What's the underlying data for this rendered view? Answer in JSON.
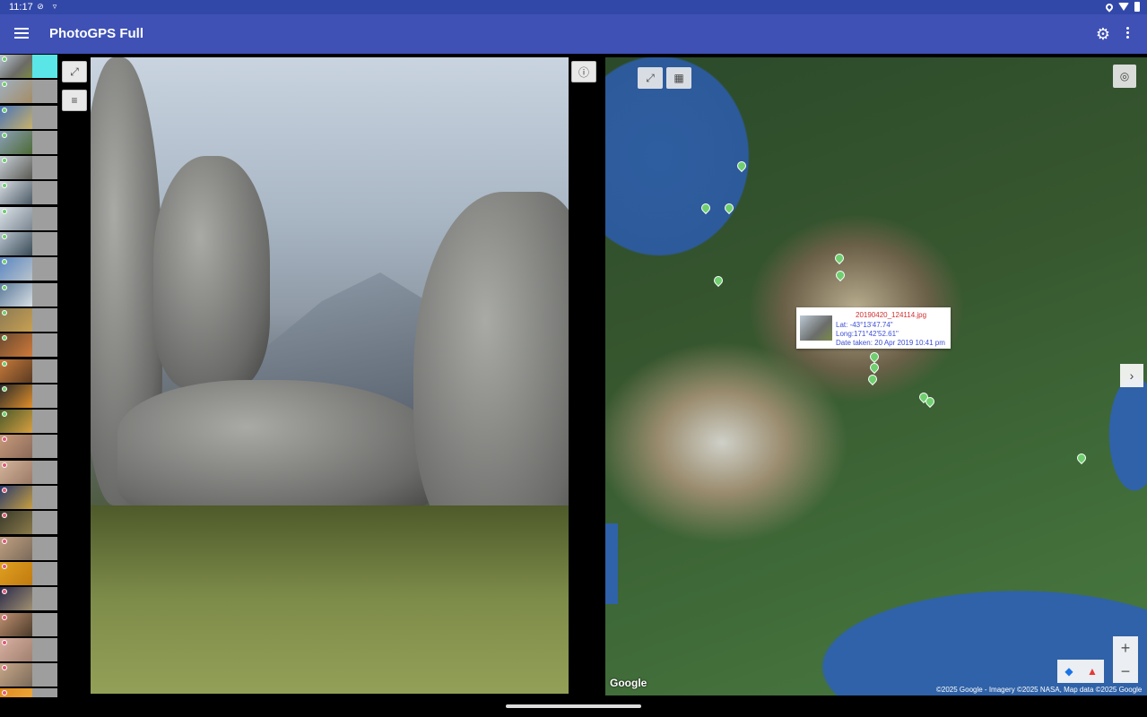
{
  "status_bar": {
    "time": "11:17"
  },
  "app_bar": {
    "title": "PhotoGPS Full"
  },
  "thumbnails": [
    {
      "bg": "linear-gradient(135deg,#b9c7d4,#6b6a66 60%,#7b8a45)",
      "dot": "#6fcf6f",
      "selected": true
    },
    {
      "bg": "linear-gradient(135deg,#9fb0c2,#a58c64)",
      "dot": "#6fcf6f"
    },
    {
      "bg": "linear-gradient(135deg,#4a74b8,#c8b26a)",
      "dot": "#6fcf6f"
    },
    {
      "bg": "linear-gradient(135deg,#8aa0b8,#4d6a34)",
      "dot": "#6fcf6f"
    },
    {
      "bg": "linear-gradient(135deg,#c8d0d8,#5a5a52)",
      "dot": "#6fcf6f"
    },
    {
      "bg": "linear-gradient(135deg,#d8dde2,#4b5a66)",
      "dot": "#6fcf6f"
    },
    {
      "bg": "linear-gradient(135deg,#dde4ea,#7a8590)",
      "dot": "#6fcf6f"
    },
    {
      "bg": "linear-gradient(135deg,#b8c4cf,#3a4a56)",
      "dot": "#6fcf6f"
    },
    {
      "bg": "linear-gradient(135deg,#5a86c2,#b9c4cc)",
      "dot": "#6fcf6f"
    },
    {
      "bg": "linear-gradient(135deg,#5b7a9a,#d8dfe4)",
      "dot": "#6fcf6f"
    },
    {
      "bg": "linear-gradient(135deg,#8c7a54,#c8a052)",
      "dot": "#6fcf6f"
    },
    {
      "bg": "linear-gradient(135deg,#6a4a30,#d07a3a)",
      "dot": "#6fcf6f"
    },
    {
      "bg": "linear-gradient(135deg,#c77a3a,#5a3a22)",
      "dot": "#6fcf6f"
    },
    {
      "bg": "linear-gradient(135deg,#2a2a2a,#e0902a)",
      "dot": "#6fcf6f"
    },
    {
      "bg": "linear-gradient(135deg,#4a5a2a,#d8a040)",
      "dot": "#6fcf6f"
    },
    {
      "bg": "linear-gradient(135deg,#c89a7a,#8a6a5a)",
      "dot": "#e05a7a"
    },
    {
      "bg": "linear-gradient(135deg,#d4b49a,#9a7a66)",
      "dot": "#e05a7a"
    },
    {
      "bg": "linear-gradient(135deg,#2a3a6a,#c8a040)",
      "dot": "#e05a7a"
    },
    {
      "bg": "linear-gradient(135deg,#3a3a2a,#8a7a4a)",
      "dot": "#e05a7a"
    },
    {
      "bg": "linear-gradient(135deg,#c0a080,#7a6a5a)",
      "dot": "#e05a7a"
    },
    {
      "bg": "linear-gradient(135deg,#e0a020,#c07a10)",
      "dot": "#e05a7a"
    },
    {
      "bg": "linear-gradient(135deg,#2a2a4a,#a09070)",
      "dot": "#e05a7a"
    },
    {
      "bg": "linear-gradient(135deg,#c09070,#4a3a2a)",
      "dot": "#e05a7a"
    },
    {
      "bg": "linear-gradient(135deg,#d8b0a0,#a08070)",
      "dot": "#e05a7a"
    },
    {
      "bg": "linear-gradient(135deg,#c8a888,#7a6a5a)",
      "dot": "#e05a7a"
    },
    {
      "bg": "linear-gradient(135deg,#e08a20,#f0b040)",
      "dot": "#e05a7a"
    }
  ],
  "info_window": {
    "filename": "20190420_124114.jpg",
    "lat": "Lat: -43°13'47.74\"",
    "long": "Long:171°42'52.61\"",
    "date": "Date taken: 20 Apr 2019 10:41 pm"
  },
  "map": {
    "google_logo": "Google",
    "attribution": "©2025 Google - Imagery ©2025 NASA, Map data ©2025 Google",
    "zoom_in": "+",
    "zoom_out": "−"
  },
  "icons": {
    "menu": "menu-icon",
    "settings": "gear-icon",
    "overflow": "more-vert-icon",
    "fullscreen": "fullscreen-icon",
    "details": "notes-icon",
    "info": "info-icon",
    "map_layers": "map-type-icon",
    "my_location": "my-location-icon",
    "next": "chevron-right-icon",
    "directions": "directions-icon",
    "google_maps": "google-maps-icon"
  }
}
